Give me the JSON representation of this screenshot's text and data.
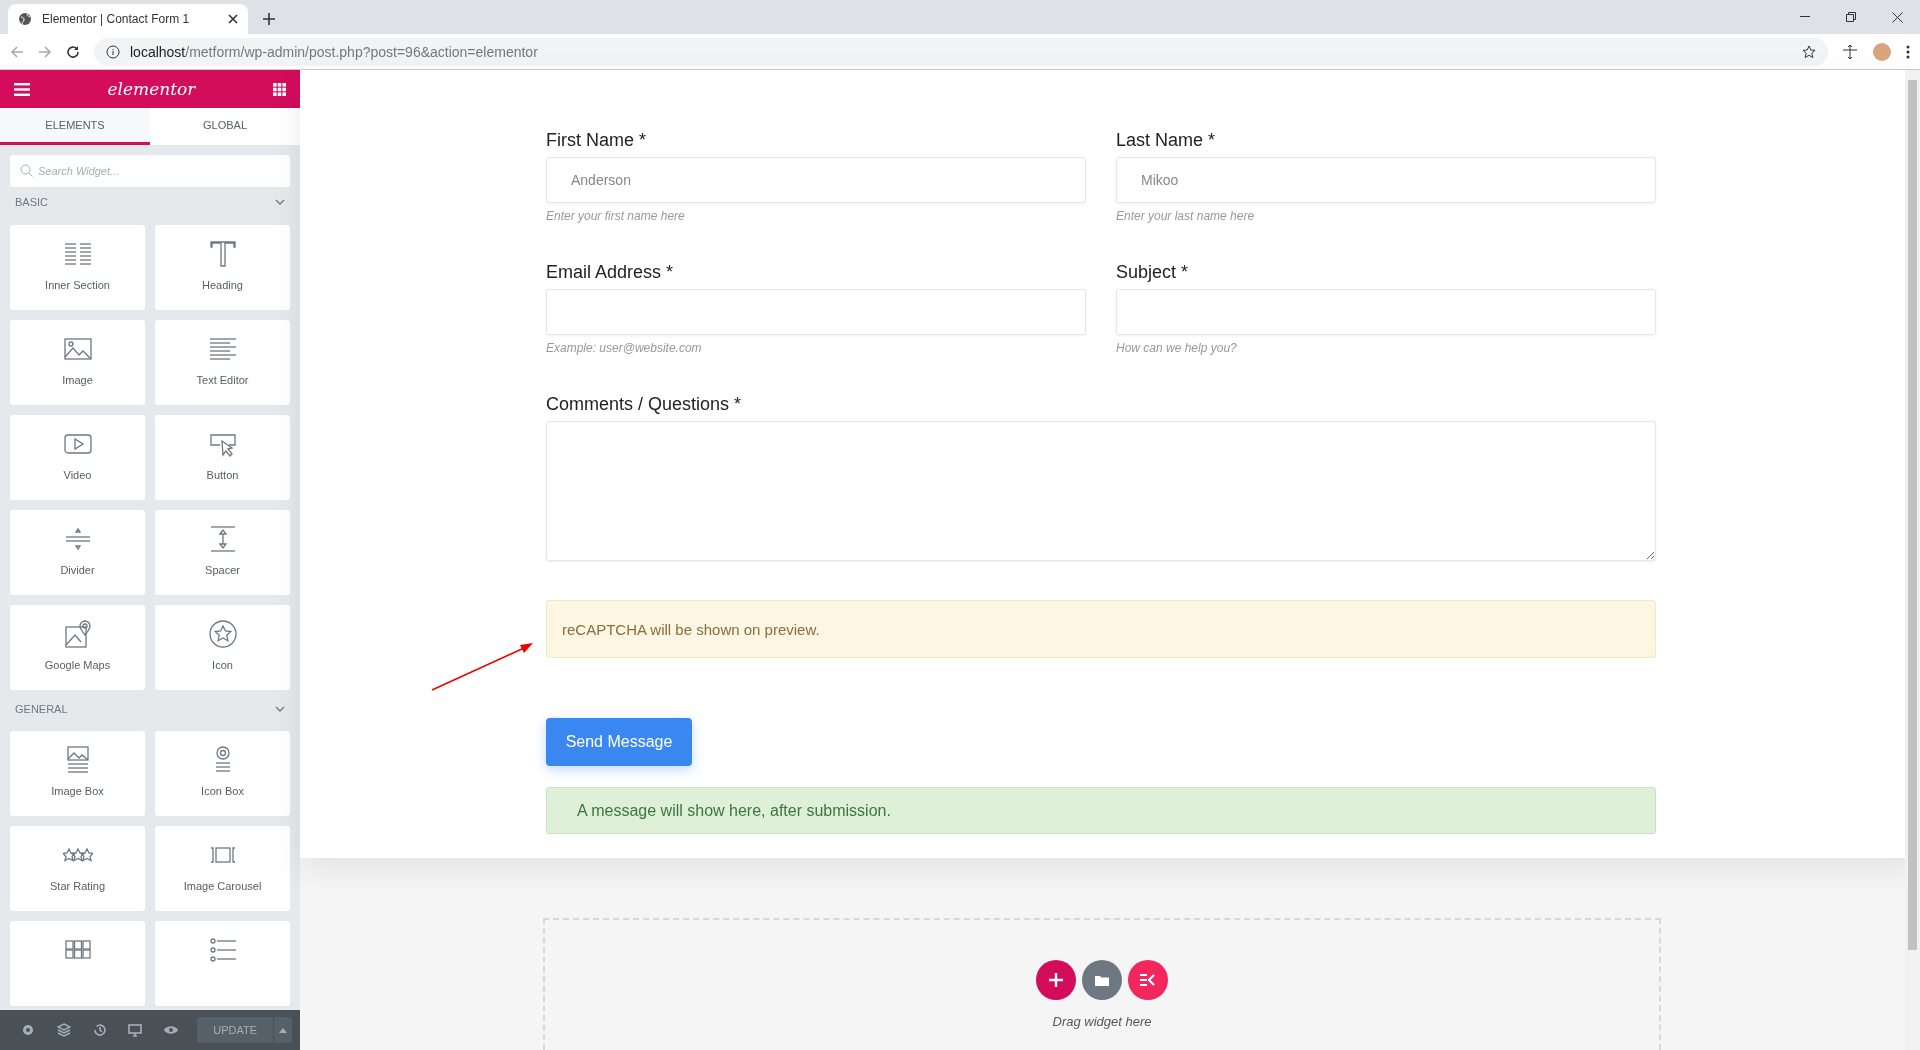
{
  "browser": {
    "tab_title": "Elementor | Contact Form 1",
    "url_host": "localhost",
    "url_path": "/metform/wp-admin/post.php?post=96&action=elementor"
  },
  "sidebar": {
    "logo": "elementor",
    "tabs": [
      {
        "label": "ELEMENTS",
        "selected": true
      },
      {
        "label": "GLOBAL",
        "selected": false
      }
    ],
    "search": {
      "placeholder": "Search Widget..."
    },
    "sections": [
      {
        "title": "BASIC",
        "expanded": true,
        "widgets": [
          {
            "label": "Inner Section",
            "kind": "columns"
          },
          {
            "label": "Heading",
            "kind": "heading"
          },
          {
            "label": "Image",
            "kind": "image"
          },
          {
            "label": "Text Editor",
            "kind": "text"
          },
          {
            "label": "Video",
            "kind": "video"
          },
          {
            "label": "Button",
            "kind": "button"
          },
          {
            "label": "Divider",
            "kind": "divider"
          },
          {
            "label": "Spacer",
            "kind": "spacer"
          },
          {
            "label": "Google Maps",
            "kind": "map"
          },
          {
            "label": "Icon",
            "kind": "icon"
          }
        ]
      },
      {
        "title": "GENERAL",
        "expanded": true,
        "widgets": [
          {
            "label": "Image Box",
            "kind": "imagebox"
          },
          {
            "label": "Icon Box",
            "kind": "iconbox"
          },
          {
            "label": "Star Rating",
            "kind": "stars"
          },
          {
            "label": "Image Carousel",
            "kind": "carousel"
          },
          {
            "kind": "grid"
          },
          {
            "kind": "list"
          }
        ]
      }
    ],
    "footer": {
      "update_label": "UPDATE"
    }
  },
  "form": {
    "rows": [
      [
        {
          "label": "First Name *",
          "placeholder": "Anderson",
          "hint": "Enter your first name here",
          "kind": "input"
        },
        {
          "label": "Last Name *",
          "placeholder": "Mikoo",
          "hint": "Enter your last name here",
          "kind": "input"
        }
      ],
      [
        {
          "label": "Email Address *",
          "hint": "Example: user@website.com",
          "kind": "input"
        },
        {
          "label": "Subject *",
          "hint": "How can we help you?",
          "kind": "input"
        }
      ],
      [
        {
          "label": "Comments / Questions *",
          "kind": "textarea"
        }
      ]
    ],
    "recaptcha_notice": "reCAPTCHA will be shown on preview.",
    "submit_label": "Send Message",
    "success_message": "A message will show here, after submission."
  },
  "dropzone": {
    "hint": "Drag widget here"
  }
}
